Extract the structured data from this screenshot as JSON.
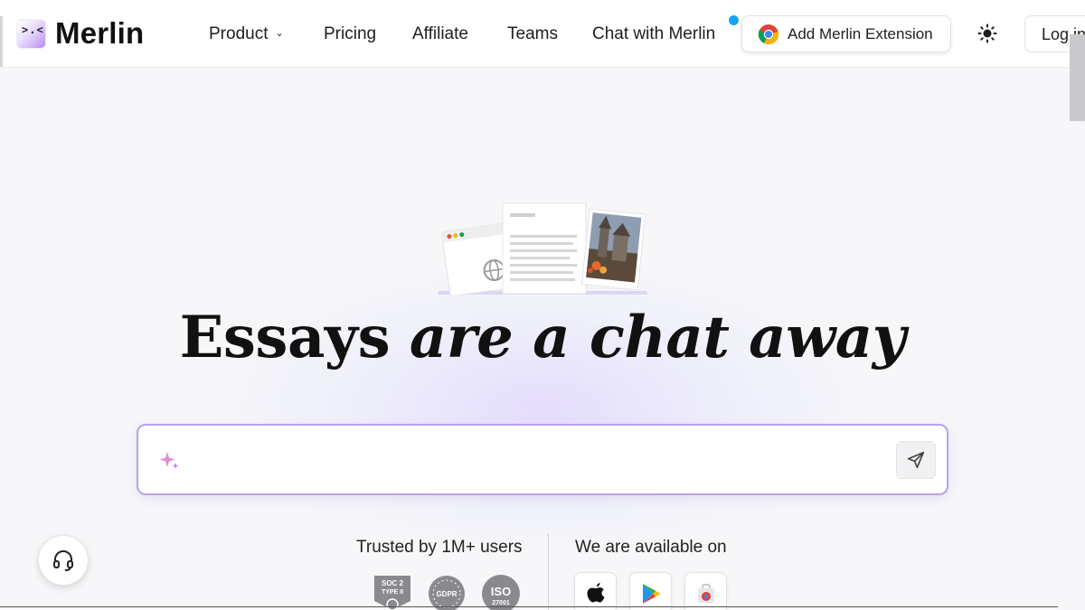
{
  "nav": {
    "logo_text": "Merlin",
    "logo_mark": ">.<",
    "links": [
      "Product",
      "Pricing",
      "Affiliate",
      "Teams",
      "Chat with Merlin"
    ],
    "extension_button": "Add Merlin Extension",
    "login_button": "Log in"
  },
  "hero": {
    "headline_bold": "Essays",
    "headline_italic": "are a chat away",
    "chat_placeholder": ""
  },
  "trust": {
    "trusted_label": "Trusted by 1M+ users",
    "available_label": "We are available on",
    "badges": [
      {
        "line1": "SOC 2",
        "line2": "TYPE II"
      },
      {
        "line1": "GDPR",
        "line2": ""
      },
      {
        "line1": "ISO",
        "line2": "27001"
      }
    ]
  },
  "colors": {
    "accent": "#b8a2ec",
    "notification": "#1aa3f0",
    "brand_purple": "#b58cf5"
  }
}
